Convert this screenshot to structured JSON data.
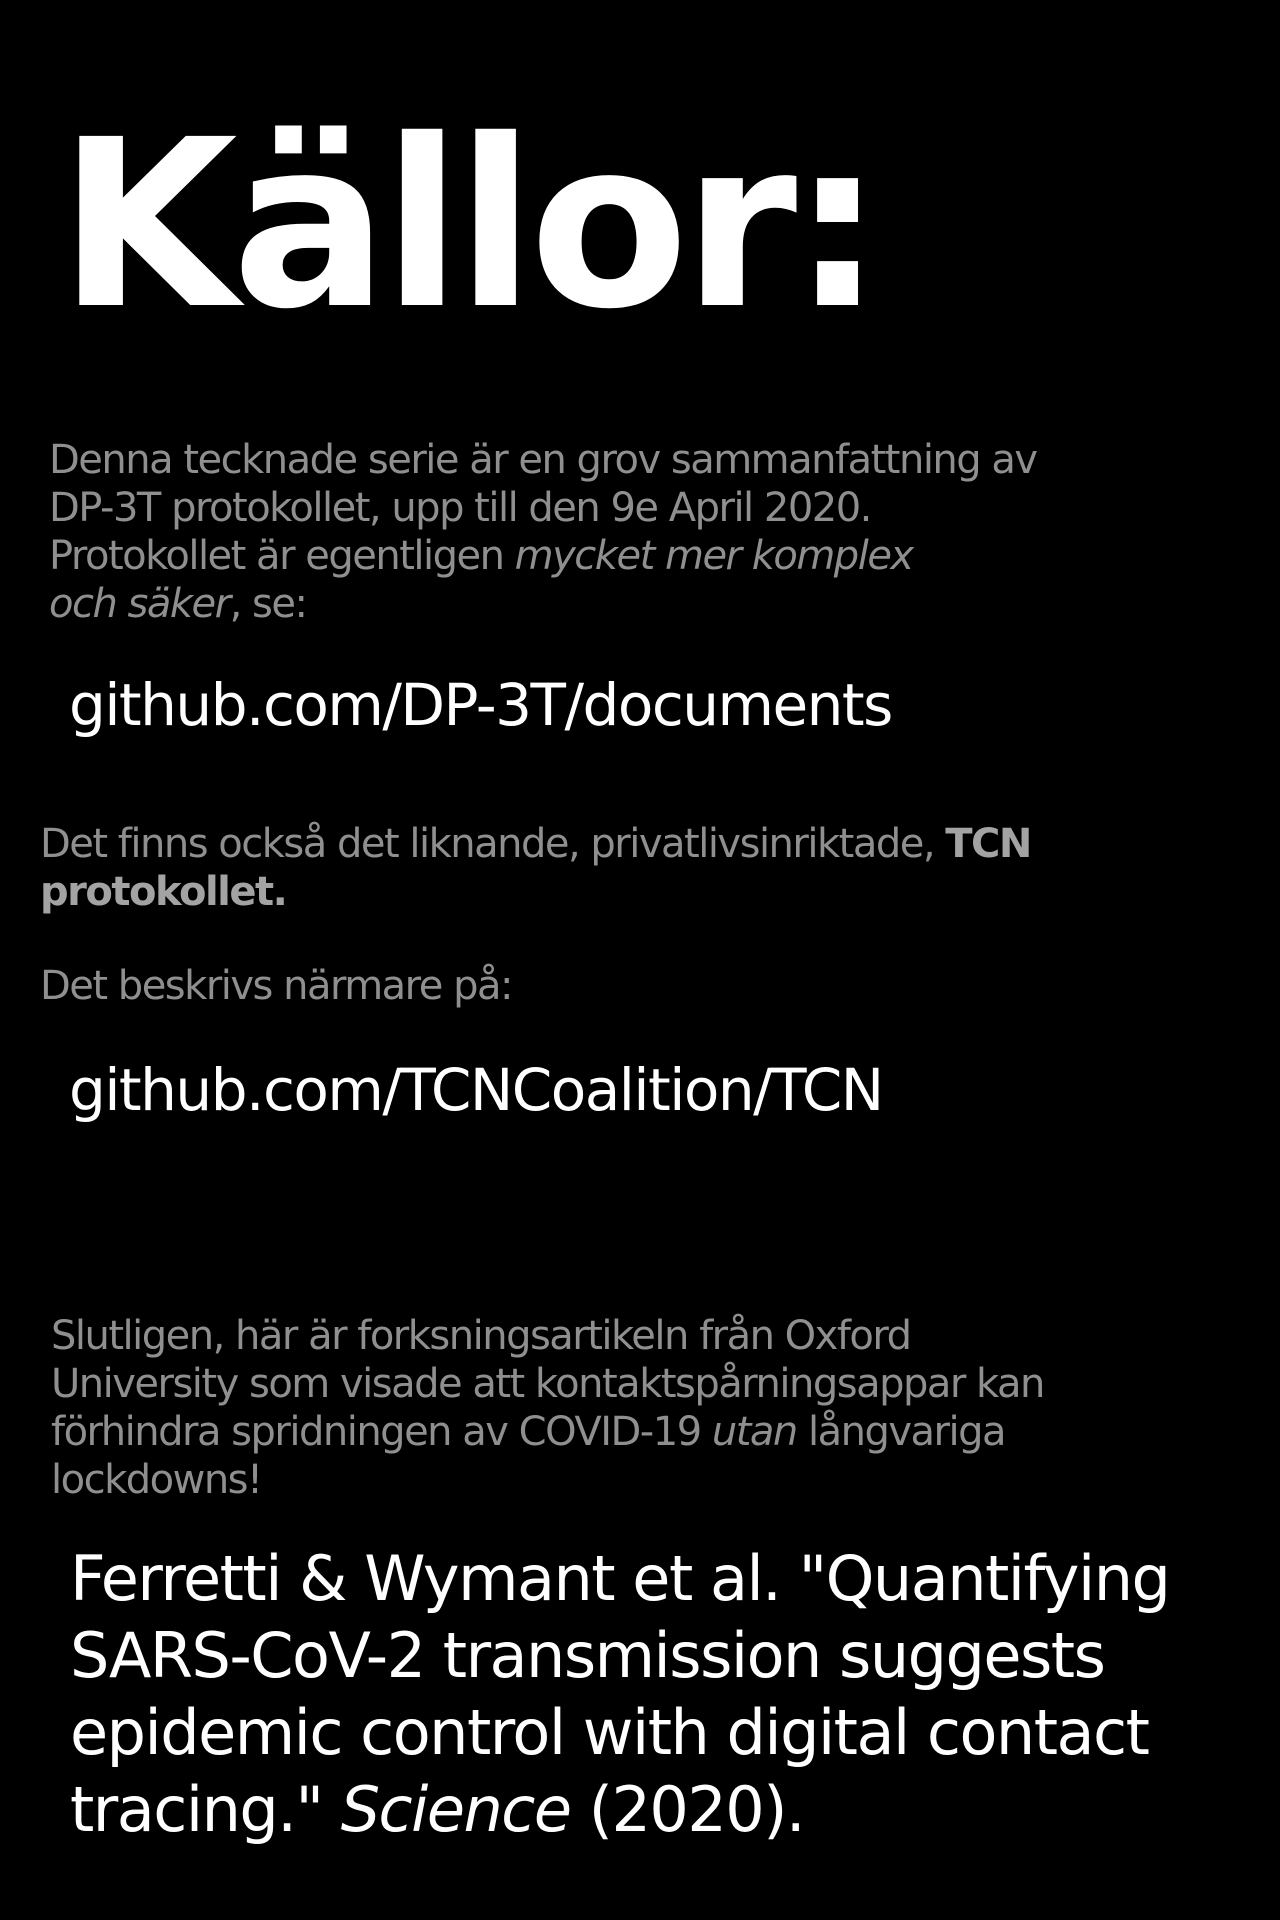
{
  "title": "Källor:",
  "intro": {
    "line1": "Denna tecknade serie är en grov sammanfattning av",
    "line2": "DP-3T protokollet, upp till den 9e April 2020.",
    "line3_plain": "Protokollet är egentligen ",
    "line3_italic": "mycket mer komplex",
    "line4_italic": "och säker",
    "line4_plain": ", se:"
  },
  "link_dp3t": "github.com/DP-3T/documents",
  "tcn_note": {
    "line1_plain": "Det finns också det liknande, privatlivsinriktade, ",
    "line1_bold": "TCN",
    "line2_bold": "protokollet."
  },
  "described_text": "Det beskrivs närmare på:",
  "link_tcn": "github.com/TCNCoalition/TCN",
  "finally": {
    "line1": "Slutligen, här är forksningsartikeln från Oxford",
    "line2": "University som visade att kontaktspårningsappar kan",
    "line3_plain": "förhindra spridningen av COVID-19 ",
    "line3_italic": "utan",
    "line3_end": " långvariga",
    "line4": "lockdowns!"
  },
  "citation": {
    "line1": "Ferretti & Wymant et al. \"Quantifying",
    "line2": "SARS-CoV-2 transmission suggests",
    "line3": "epidemic control with digital contact",
    "line4_plain": "tracing.\" ",
    "line4_italic": "Science",
    "line4_end": " (2020)."
  }
}
